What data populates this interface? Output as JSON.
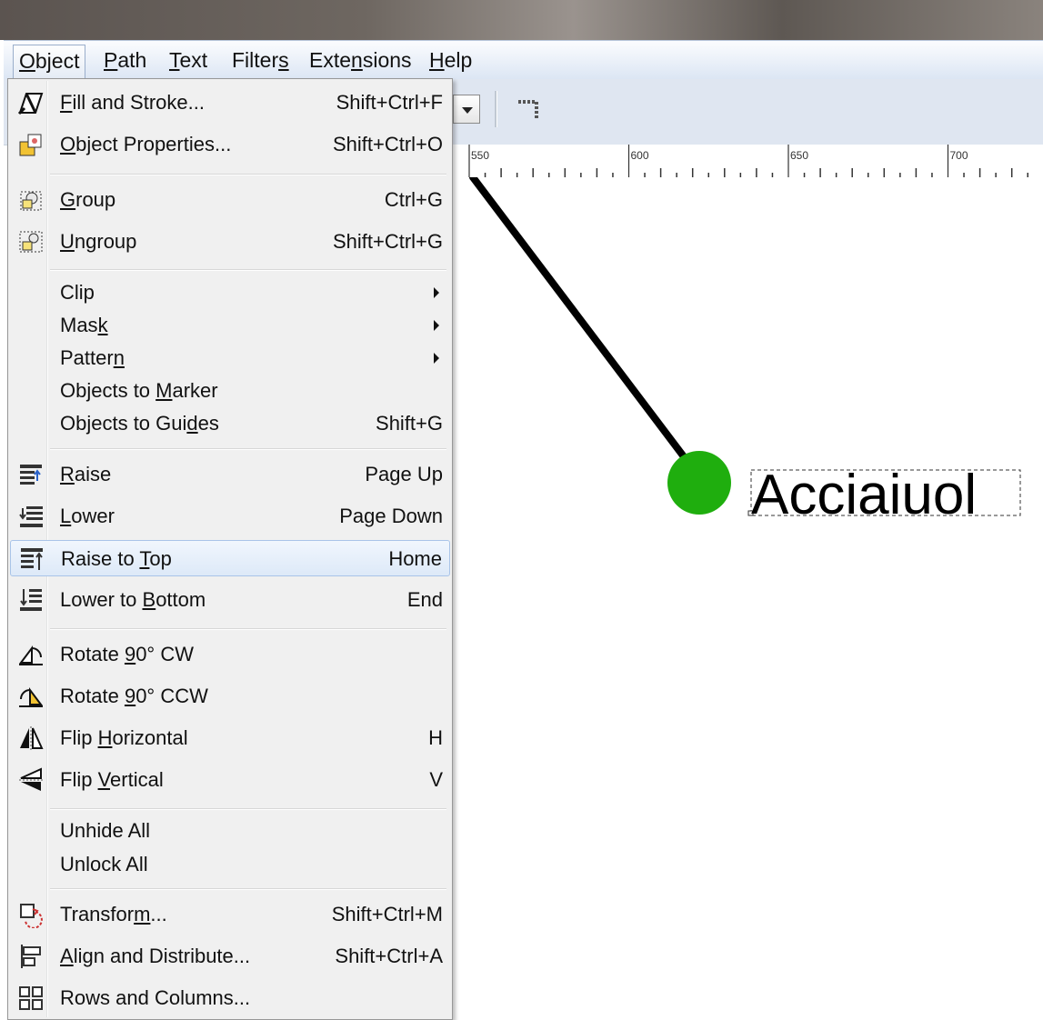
{
  "menubar": {
    "items": [
      {
        "label": "Object",
        "u": 0,
        "active": true
      },
      {
        "label": "Path",
        "u": 0
      },
      {
        "label": "Text",
        "u": 0
      },
      {
        "label": "Filters",
        "u": 6
      },
      {
        "label": "Extensions",
        "u": 4
      },
      {
        "label": "Help",
        "u": 0
      }
    ]
  },
  "ruler": {
    "labels": [
      "550",
      "600",
      "650",
      "700"
    ]
  },
  "menu": {
    "items": [
      {
        "label": "Fill and Stroke...",
        "u": 0,
        "shortcut": "Shift+Ctrl+F",
        "icon": "fill-stroke-icon"
      },
      {
        "label": "Object Properties...",
        "u": 0,
        "shortcut": "Shift+Ctrl+O",
        "icon": "object-properties-icon"
      },
      {
        "label": "Group",
        "u": 0,
        "shortcut": "Ctrl+G",
        "icon": "group-icon"
      },
      {
        "label": "Ungroup",
        "u": 0,
        "shortcut": "Shift+Ctrl+G",
        "icon": "ungroup-icon"
      },
      {
        "label": "Clip",
        "u": -1,
        "submenu": true
      },
      {
        "label": "Mask",
        "u": 3,
        "submenu": true
      },
      {
        "label": "Pattern",
        "u": 6,
        "submenu": true
      },
      {
        "label": "Objects to Marker",
        "u": 11
      },
      {
        "label": "Objects to Guides",
        "u": 14,
        "shortcut": "Shift+G"
      },
      {
        "label": "Raise",
        "u": 0,
        "shortcut": "Page Up",
        "icon": "raise-icon"
      },
      {
        "label": "Lower",
        "u": 0,
        "shortcut": "Page Down",
        "icon": "lower-icon"
      },
      {
        "label": "Raise to Top",
        "u": 9,
        "shortcut": "Home",
        "icon": "raise-to-top-icon",
        "highlight": true
      },
      {
        "label": "Lower to Bottom",
        "u": 9,
        "shortcut": "End",
        "icon": "lower-to-bottom-icon"
      },
      {
        "label": "Rotate 90° CW",
        "u": 7,
        "icon": "rotate-cw-icon"
      },
      {
        "label": "Rotate 90° CCW",
        "u": 7,
        "icon": "rotate-ccw-icon"
      },
      {
        "label": "Flip Horizontal",
        "u": 5,
        "shortcut": "H",
        "icon": "flip-horizontal-icon"
      },
      {
        "label": "Flip Vertical",
        "u": 5,
        "shortcut": "V",
        "icon": "flip-vertical-icon"
      },
      {
        "label": "Unhide All",
        "u": -1
      },
      {
        "label": "Unlock All",
        "u": -1
      },
      {
        "label": "Transform...",
        "u": 8,
        "shortcut": "Shift+Ctrl+M",
        "icon": "transform-icon"
      },
      {
        "label": "Align and Distribute...",
        "u": 0,
        "shortcut": "Shift+Ctrl+A",
        "icon": "align-distribute-icon"
      },
      {
        "label": "Rows and Columns...",
        "u": -1,
        "icon": "rows-columns-icon"
      }
    ]
  },
  "canvas": {
    "text": "Acciaiuol",
    "colors": {
      "circle": "#1fae0e",
      "line": "#000000",
      "text": "#000000"
    }
  }
}
